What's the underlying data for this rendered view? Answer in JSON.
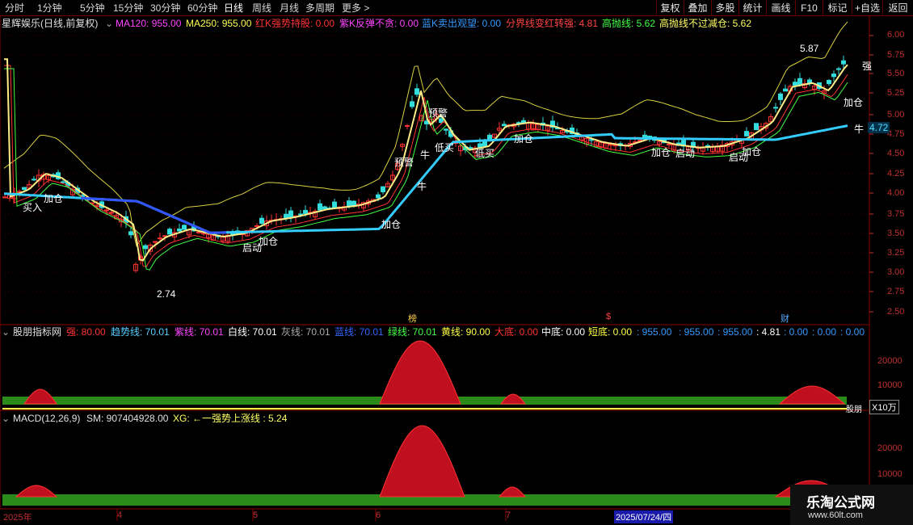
{
  "toolbar": {
    "periods": [
      "分时",
      "1分钟",
      "5分钟",
      "15分钟",
      "30分钟",
      "60分钟",
      "日线",
      "周线",
      "月线",
      "多周期",
      "更多 >"
    ],
    "active_period": "日线",
    "buttons": [
      "复权",
      "叠加",
      "多股",
      "统计",
      "画线",
      "F10",
      "标记",
      "+自选",
      "返回"
    ]
  },
  "main_legend": {
    "title": "星辉娱乐(日线,前复权)",
    "items": [
      {
        "text": "MA120: 955.00",
        "color": "#ff44ff"
      },
      {
        "text": "MA250: 955.00",
        "color": "#ffff55"
      },
      {
        "text": "红K强势持股: 0.00",
        "color": "#ff3333"
      },
      {
        "text": "紫K反弹不贪: 0.00",
        "color": "#ff44ff"
      },
      {
        "text": "蓝K卖出观望: 0.00",
        "color": "#3399ff"
      },
      {
        "text": "分界线变红转强: 4.81",
        "color": "#ff4444"
      },
      {
        "text": "高抛线: 5.62",
        "color": "#44ff44"
      },
      {
        "text": "高抛线不过减仓: 5.62",
        "color": "#ffff66"
      }
    ]
  },
  "price_axis": [
    "6.00",
    "5.75",
    "5.50",
    "5.25",
    "5.00",
    "4.75",
    "4.50",
    "4.25",
    "4.00",
    "3.75",
    "3.50",
    "3.25",
    "3.00",
    "2.75",
    "2.50"
  ],
  "annotations": {
    "high": "5.87",
    "low": "2.74",
    "buy": "买入",
    "add1": "加仓",
    "add2": "加仓",
    "add3": "加仓",
    "add4": "加仓",
    "add5": "加仓",
    "add6": "加仓",
    "start1": "启动",
    "start2": "启动",
    "start3": "启动",
    "warn1": "预警",
    "warn2": "预警",
    "niu1": "牛",
    "niu2": "牛",
    "low_buy1": "低买",
    "low_buy2": "低买",
    "bull_label": "牛",
    "bull_value": "4.72",
    "marker1": "榜",
    "marker2": "$",
    "marker3": "财",
    "qiang": "强"
  },
  "ind1_legend": {
    "title": "股朋指标网",
    "items": [
      {
        "text": "强: 80.00",
        "color": "#ff3333"
      },
      {
        "text": "趋势线: 70.01",
        "color": "#55ccff"
      },
      {
        "text": "紫线: 70.01",
        "color": "#ff44ff"
      },
      {
        "text": "白线: 70.01",
        "color": "#ffffff"
      },
      {
        "text": "灰线: 70.01",
        "color": "#aaaaaa"
      },
      {
        "text": "蓝线: 70.01",
        "color": "#3366ff"
      },
      {
        "text": "绿线: 70.01",
        "color": "#44ff44"
      },
      {
        "text": "黄线: 90.00",
        "color": "#ffff44"
      },
      {
        "text": "大底: 0.00",
        "color": "#ff3333"
      },
      {
        "text": "中底: 0.00",
        "color": "#ffffff"
      },
      {
        "text": "短底: 0.00",
        "color": "#ffff44"
      },
      {
        "text": ": 955.00",
        "color": "#3399ff"
      },
      {
        "text": ": 955.00",
        "color": "#3399ff"
      },
      {
        "text": ": 955.00",
        "color": "#3399ff"
      },
      {
        "text": ": 4.81",
        "color": "#ffffff"
      },
      {
        "text": ": 0.00",
        "color": "#3399ff"
      },
      {
        "text": ": 0.00",
        "color": "#3399ff"
      },
      {
        "text": ": 0.00",
        "color": "#3399ff"
      }
    ],
    "axis": [
      "20000",
      "10000"
    ],
    "unit": "X10万",
    "corner": "股朋"
  },
  "ind2_legend": {
    "title": "MACD(12,26,9)",
    "sm": "SM: 907404928.00",
    "xg": "XG: ←一强势上涨线 : 5.24",
    "axis": [
      "20000",
      "10000"
    ]
  },
  "dates": [
    "2025年",
    "4",
    "5",
    "6",
    "7",
    "2025/07/24/四"
  ],
  "watermark": {
    "title": "乐淘公式网",
    "url": "www.60lt.com"
  }
}
